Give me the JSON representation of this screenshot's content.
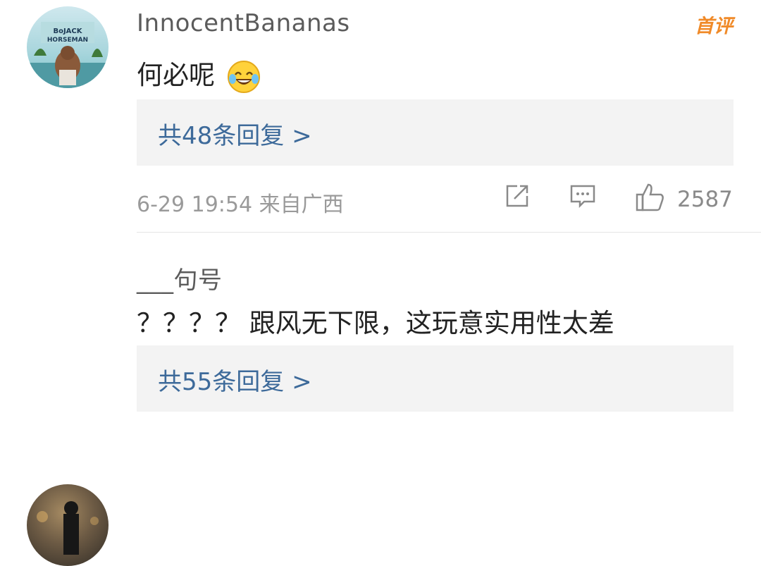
{
  "comments": [
    {
      "username": "InnocentBananas",
      "badge": "首评",
      "text": "何必呢",
      "emoji": "laughing-crying-emoji",
      "replies": "共48条回复 >",
      "meta": "6-29 19:54 来自广西",
      "likes": "2587",
      "avatar_text": "BoJACK HORSEMAN"
    },
    {
      "username": "___句号",
      "text": "？？？？ 跟风无下限，这玩意实用性太差",
      "replies": "共55条回复 >"
    }
  ],
  "icons": {
    "share": "share-icon",
    "comment": "comment-icon",
    "like": "thumbs-up-icon"
  },
  "colors": {
    "link": "#3d6a9a",
    "badge": "#f08a28",
    "username": "#5b5b5b",
    "meta": "#9a9a9a",
    "reply_bg": "#f3f3f3"
  }
}
